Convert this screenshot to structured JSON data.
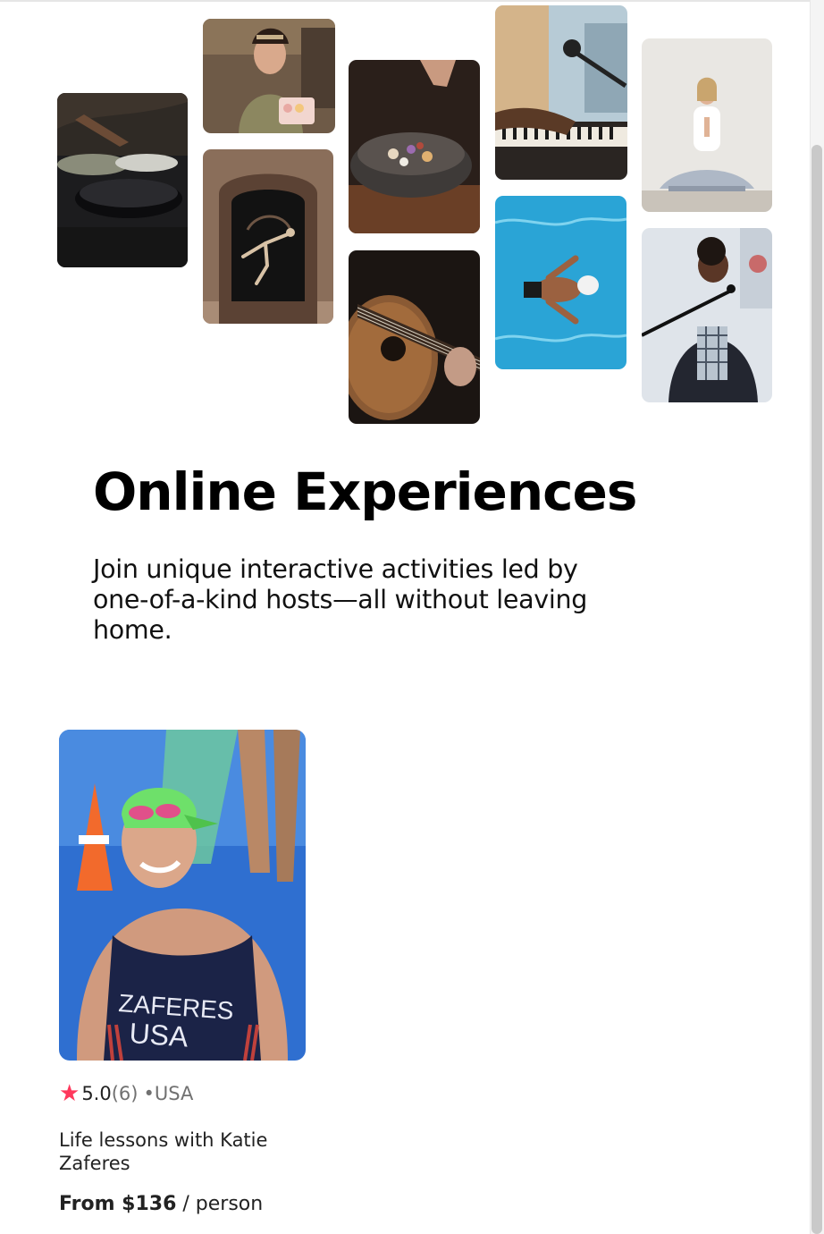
{
  "hero": {
    "title": "Online Experiences",
    "subtitle": "Join unique interactive activities led by one-of-a-kind hosts—all without leaving home."
  },
  "collage": [
    {
      "name": "cooking-pans-photo"
    },
    {
      "name": "baker-macarons-photo"
    },
    {
      "name": "dancer-doorway-photo"
    },
    {
      "name": "food-bowl-photo"
    },
    {
      "name": "guitar-photo"
    },
    {
      "name": "piano-microphone-photo"
    },
    {
      "name": "swimmer-pool-photo"
    },
    {
      "name": "yoga-meditation-photo"
    },
    {
      "name": "singer-microphone-photo"
    }
  ],
  "card": {
    "photo_jersey_line1": "ZAFERES",
    "photo_jersey_line2": "USA",
    "star_icon": "★",
    "rating": "5.0",
    "reviews": "(6)",
    "location": "•USA",
    "title": "Life lessons with Katie Zaferes",
    "price_from": "From $136",
    "price_unit": " / person"
  },
  "colors": {
    "accent_star": "#ff385c",
    "muted_text": "#717171",
    "text": "#222222"
  }
}
